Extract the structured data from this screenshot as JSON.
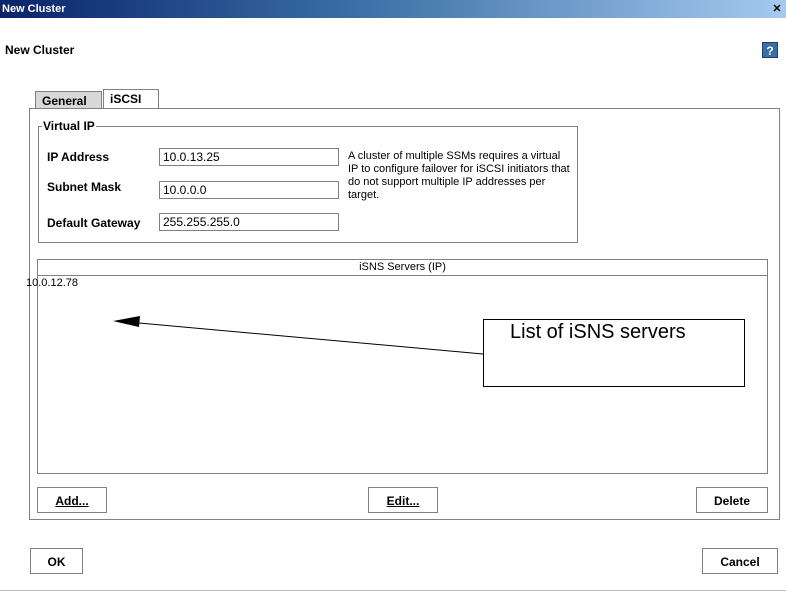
{
  "window": {
    "title": "New Cluster",
    "close_glyph": "✕"
  },
  "dialog": {
    "heading": "New Cluster",
    "help_glyph": "?"
  },
  "tabs": [
    {
      "label": "General",
      "active": false
    },
    {
      "label": "iSCSI",
      "active": true
    }
  ],
  "virtual_ip": {
    "legend": "Virtual IP",
    "fields": [
      {
        "label": "IP Address",
        "value": "10.0.13.25"
      },
      {
        "label": "Subnet Mask",
        "value": "10.0.0.0"
      },
      {
        "label": "Default Gateway",
        "value": "255.255.255.0"
      }
    ],
    "help_text": "A cluster of multiple SSMs requires a virtual IP to configure failover for iSCSI initiators that do not support multiple IP addresses per target."
  },
  "isns_table": {
    "header": "iSNS Servers (IP)",
    "rows": [
      "10.0.12.78"
    ]
  },
  "callout": {
    "text": "List of iSNS servers"
  },
  "buttons": {
    "add": "Add...",
    "edit": "Edit...",
    "delete": "Delete",
    "ok": "OK",
    "cancel": "Cancel"
  }
}
